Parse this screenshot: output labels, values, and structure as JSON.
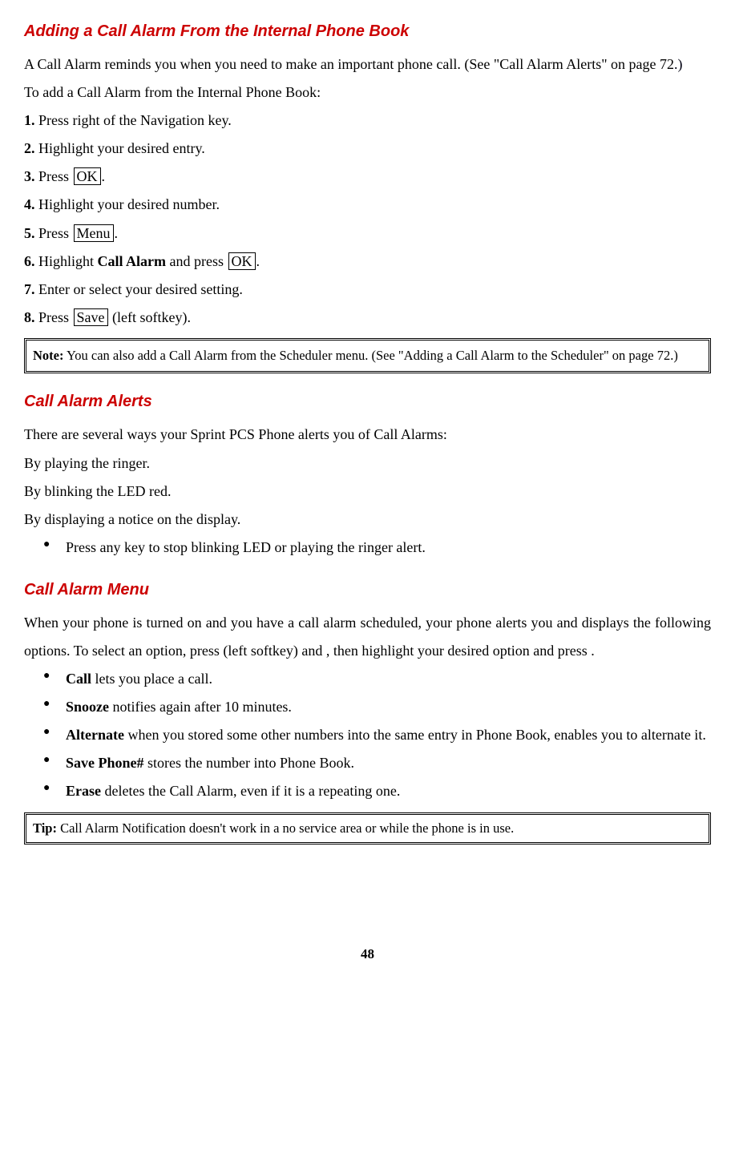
{
  "section1": {
    "heading": "Adding a Call Alarm From the Internal Phone Book",
    "intro_a": "A Call Alarm reminds you when you need to make an important phone call. (See \"Call Alarm Alerts\" on page 72",
    "intro_b": ".)",
    "lead": "To add a Call Alarm from the Internal Phone Book:",
    "steps": {
      "s1_num": "1.",
      "s1_text": " Press right of the Navigation key.",
      "s2_num": "2.",
      "s2_text": " Highlight your desired entry.",
      "s3_num": "3.",
      "s3_pre": " Press ",
      "s3_box": "OK",
      "s3_post": ".",
      "s4_num": "4.",
      "s4_text": " Highlight your desired number.",
      "s5_num": "5.",
      "s5_pre": " Press ",
      "s5_box": "Menu",
      "s5_post": ".",
      "s6_num": "6.",
      "s6_pre": " Highlight ",
      "s6_bold": "Call Alarm",
      "s6_mid": " and press ",
      "s6_box": "OK",
      "s6_post": ".",
      "s7_num": "7.",
      "s7_text": " Enter or select your desired setting.",
      "s8_num": "8.",
      "s8_pre": " Press ",
      "s8_box": "Save",
      "s8_post": " (left softkey)."
    },
    "note_label": "Note:",
    "note_text": " You can also add a Call Alarm from the Scheduler menu. (See \"Adding a Call Alarm to the Scheduler\" on page 72.)"
  },
  "section2": {
    "heading": "Call Alarm Alerts",
    "intro": "There are several ways your Sprint PCS Phone alerts you of Call Alarms:",
    "l1": "By playing the ringer.",
    "l2": "By blinking the LED red.",
    "l3": "By displaying a notice on the display.",
    "bullet": "Press any key to stop blinking LED or playing the ringer alert."
  },
  "section3": {
    "heading": "Call Alarm Menu",
    "intro": "When your phone is turned on and you have a call alarm scheduled, your phone alerts you and displays the following options. To select an option, press (left softkey) and , then highlight your desired option and press .",
    "items": {
      "b1_bold": "Call",
      "b1_text": " lets you place a call.",
      "b2_bold": "Snooze",
      "b2_text": " notifies again after 10 minutes.",
      "b3_bold": "Alternate",
      "b3_text": " when you stored some other numbers into the same entry in Phone Book, enables you to alternate it.",
      "b4_bold": "Save Phone#",
      "b4_text": " stores the number into Phone Book.",
      "b5_bold": "Erase",
      "b5_text": " deletes the Call Alarm, even if it is a repeating one."
    },
    "tip_label": "Tip:",
    "tip_text": " Call Alarm Notification doesn't work in a no service area or while the phone is in use."
  },
  "page_number": "48"
}
